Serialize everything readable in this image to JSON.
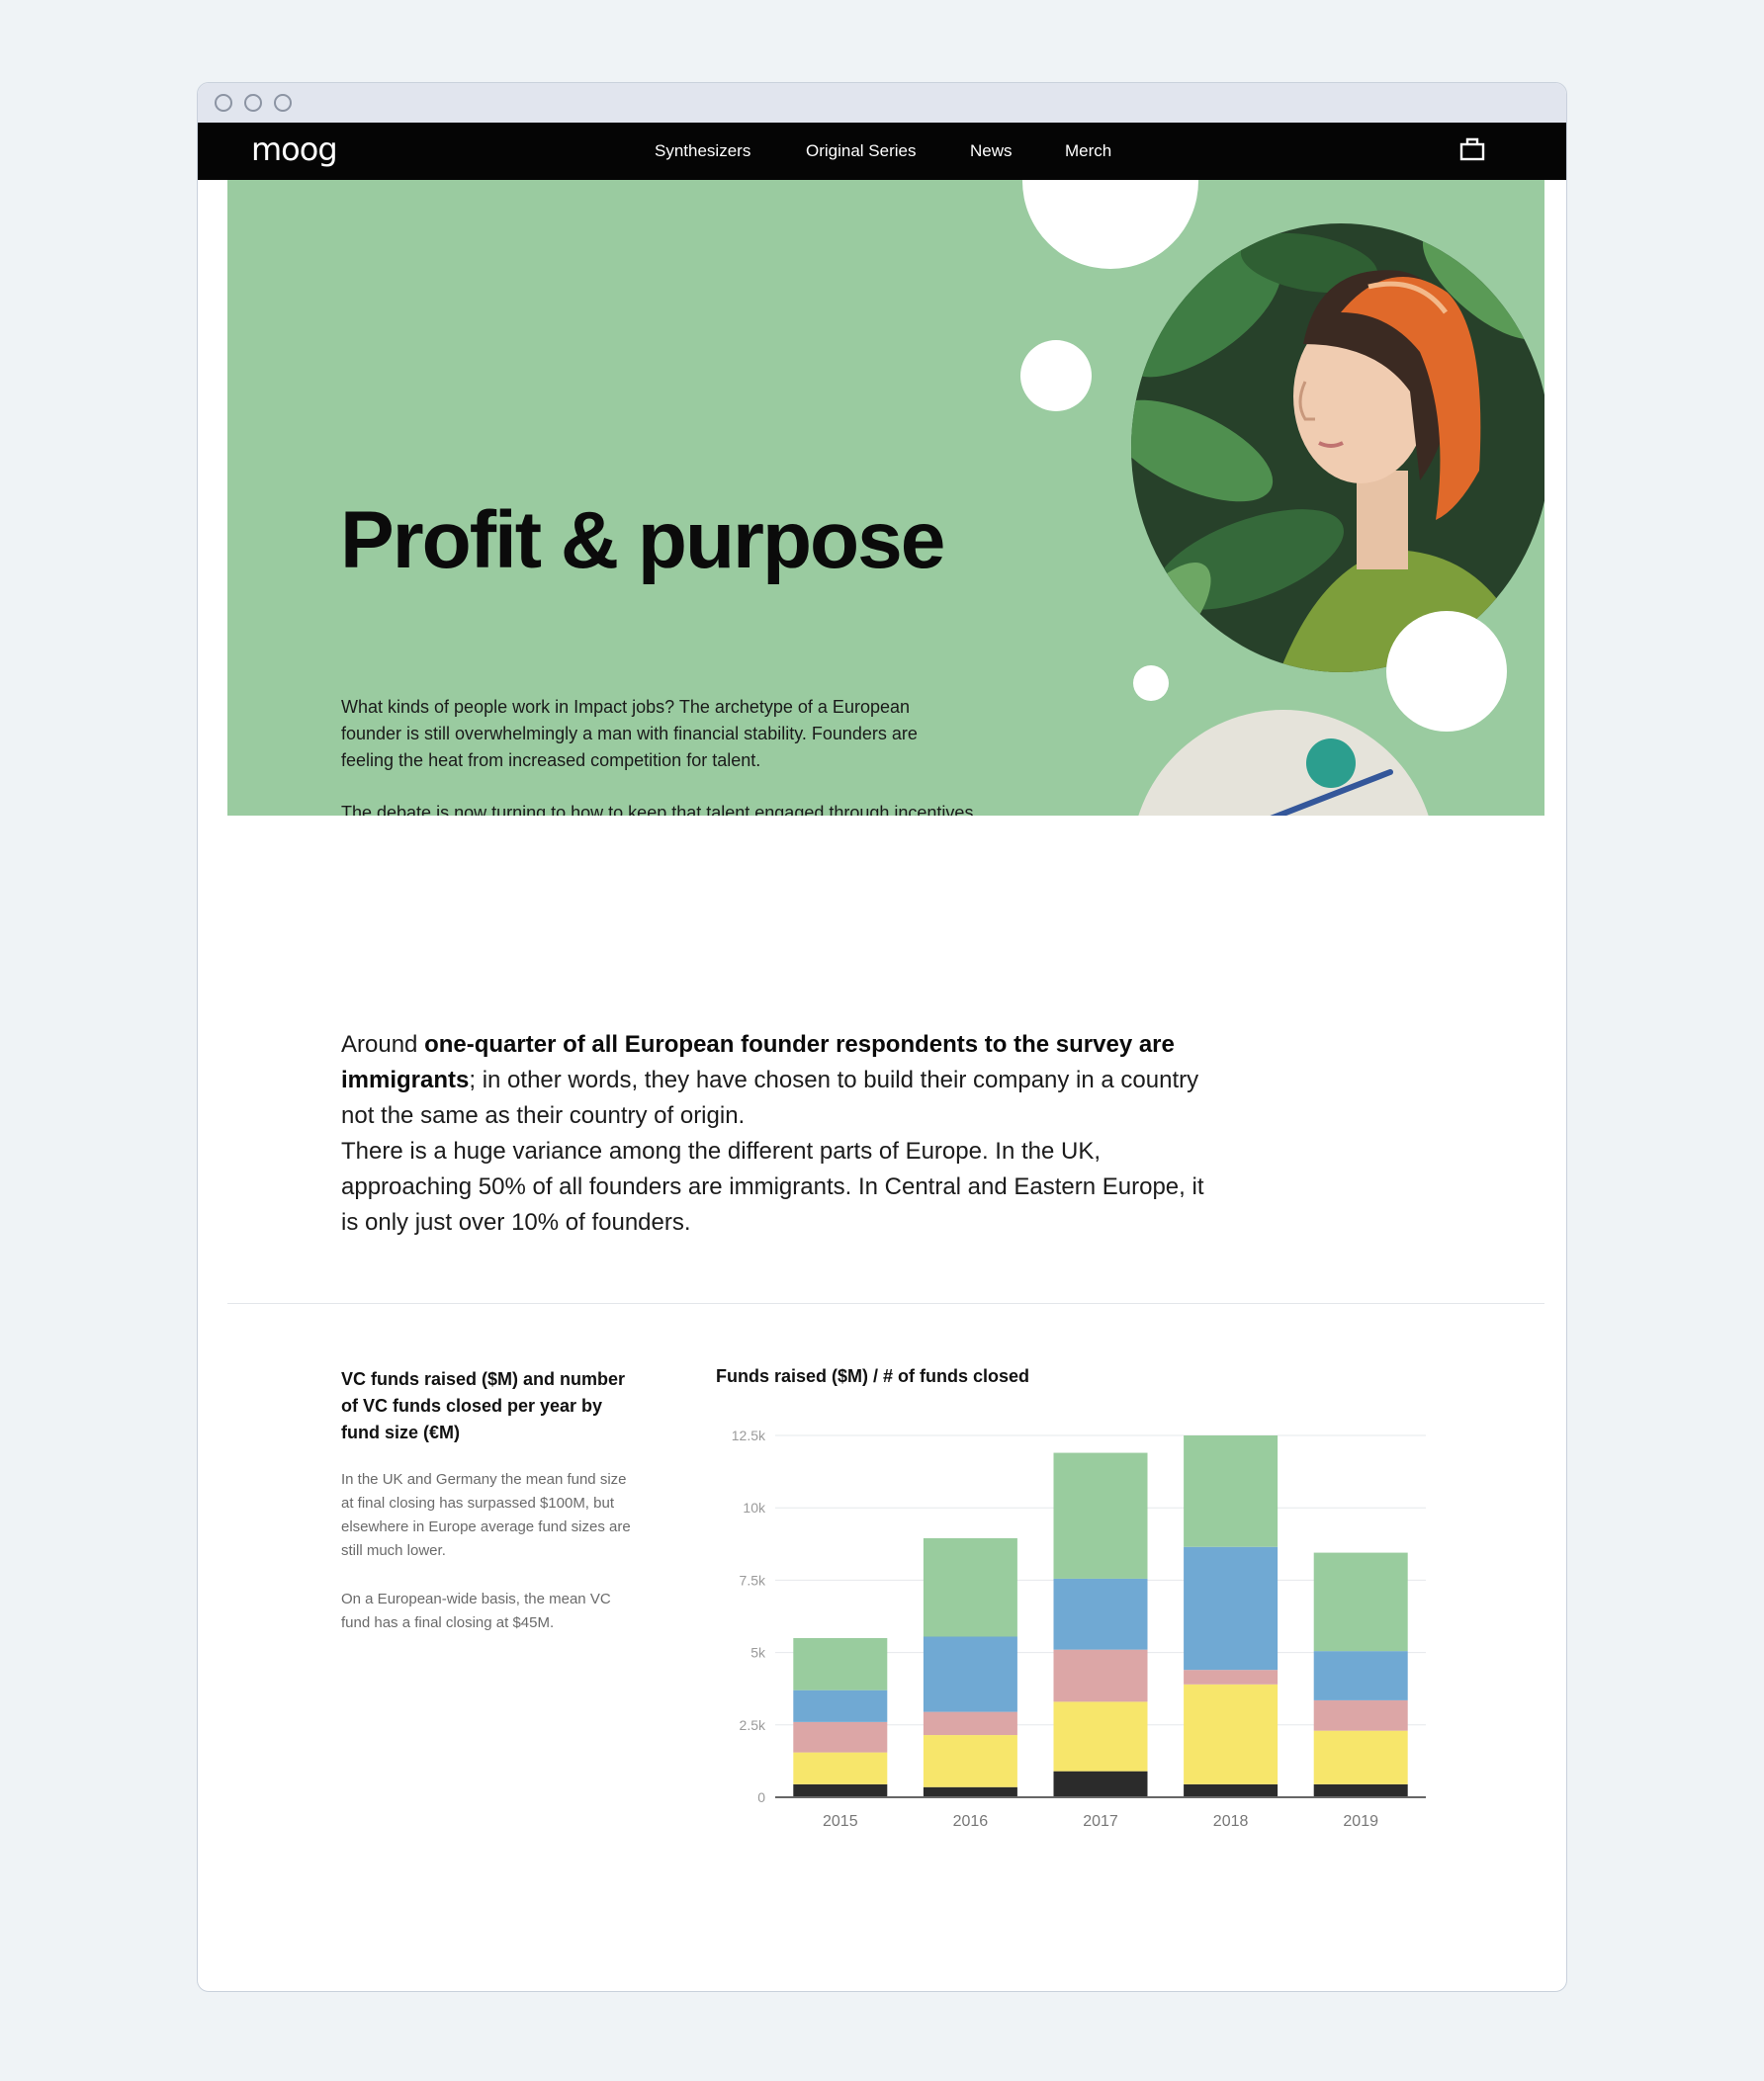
{
  "nav": {
    "logo": "moog",
    "links": [
      "Synthesizers",
      "Original Series",
      "News",
      "Merch"
    ]
  },
  "icons": {
    "cart": "shopping-bag-icon",
    "portrait": "portrait-photo",
    "balance": "balance-illustration"
  },
  "hero": {
    "title": "Profit & purpose",
    "paragraph1": "What kinds of people work in Impact jobs? The archetype of a European founder is still overwhelmingly a man with financial stability. Founders are feeling the heat from increased competition for talent.",
    "paragraph2": "The debate is now turning to how to keep that talent engaged through incentives and stock options, and healthy through discussions of mental health and wellness."
  },
  "lead": {
    "text_before": "Around ",
    "bold": "one-quarter of all European founder respondents to the survey are immigrants",
    "text_after": "; in other words, they have chosen to build their company in a country not the same as their country of origin.",
    "second": "There is a huge variance among the different parts of Europe. In the UK, approaching 50% of all founders are immigrants. In Central and Eastern Europe, it is only just over 10% of founders."
  },
  "sidebar": {
    "title": "VC funds raised ($M) and number of VC funds closed per year by fund size (€M)",
    "paragraph1": "In the UK and Germany the mean fund size at final closing has surpassed $100M, but elsewhere in Europe average fund sizes are still much lower.",
    "paragraph2": "On a European-wide basis, the mean VC fund has a final closing at $45M."
  },
  "colors": {
    "hero_bg": "#9acba0",
    "nav_bg": "#050505",
    "segments": [
      "#2b2b2b",
      "#f7e66b",
      "#dca6a6",
      "#70a9d3",
      "#99cc9e"
    ]
  },
  "chart_data": {
    "type": "bar",
    "stacked": true,
    "title": "Funds raised ($M) / # of funds closed",
    "categories": [
      "2015",
      "2016",
      "2017",
      "2018",
      "2019"
    ],
    "y_tick_labels": [
      "0",
      "2.5k",
      "5k",
      "7.5k",
      "10k",
      "12.5k"
    ],
    "ylim": [
      0,
      12500
    ],
    "grid": true,
    "series": [
      {
        "values": [
          450,
          350,
          900,
          450,
          450
        ]
      },
      {
        "values": [
          1100,
          1800,
          2400,
          3450,
          1850
        ]
      },
      {
        "values": [
          1050,
          800,
          1800,
          500,
          1050
        ]
      },
      {
        "values": [
          1100,
          2600,
          2450,
          4250,
          1700
        ]
      },
      {
        "values": [
          1800,
          3400,
          4350,
          3850,
          3400
        ]
      }
    ]
  }
}
